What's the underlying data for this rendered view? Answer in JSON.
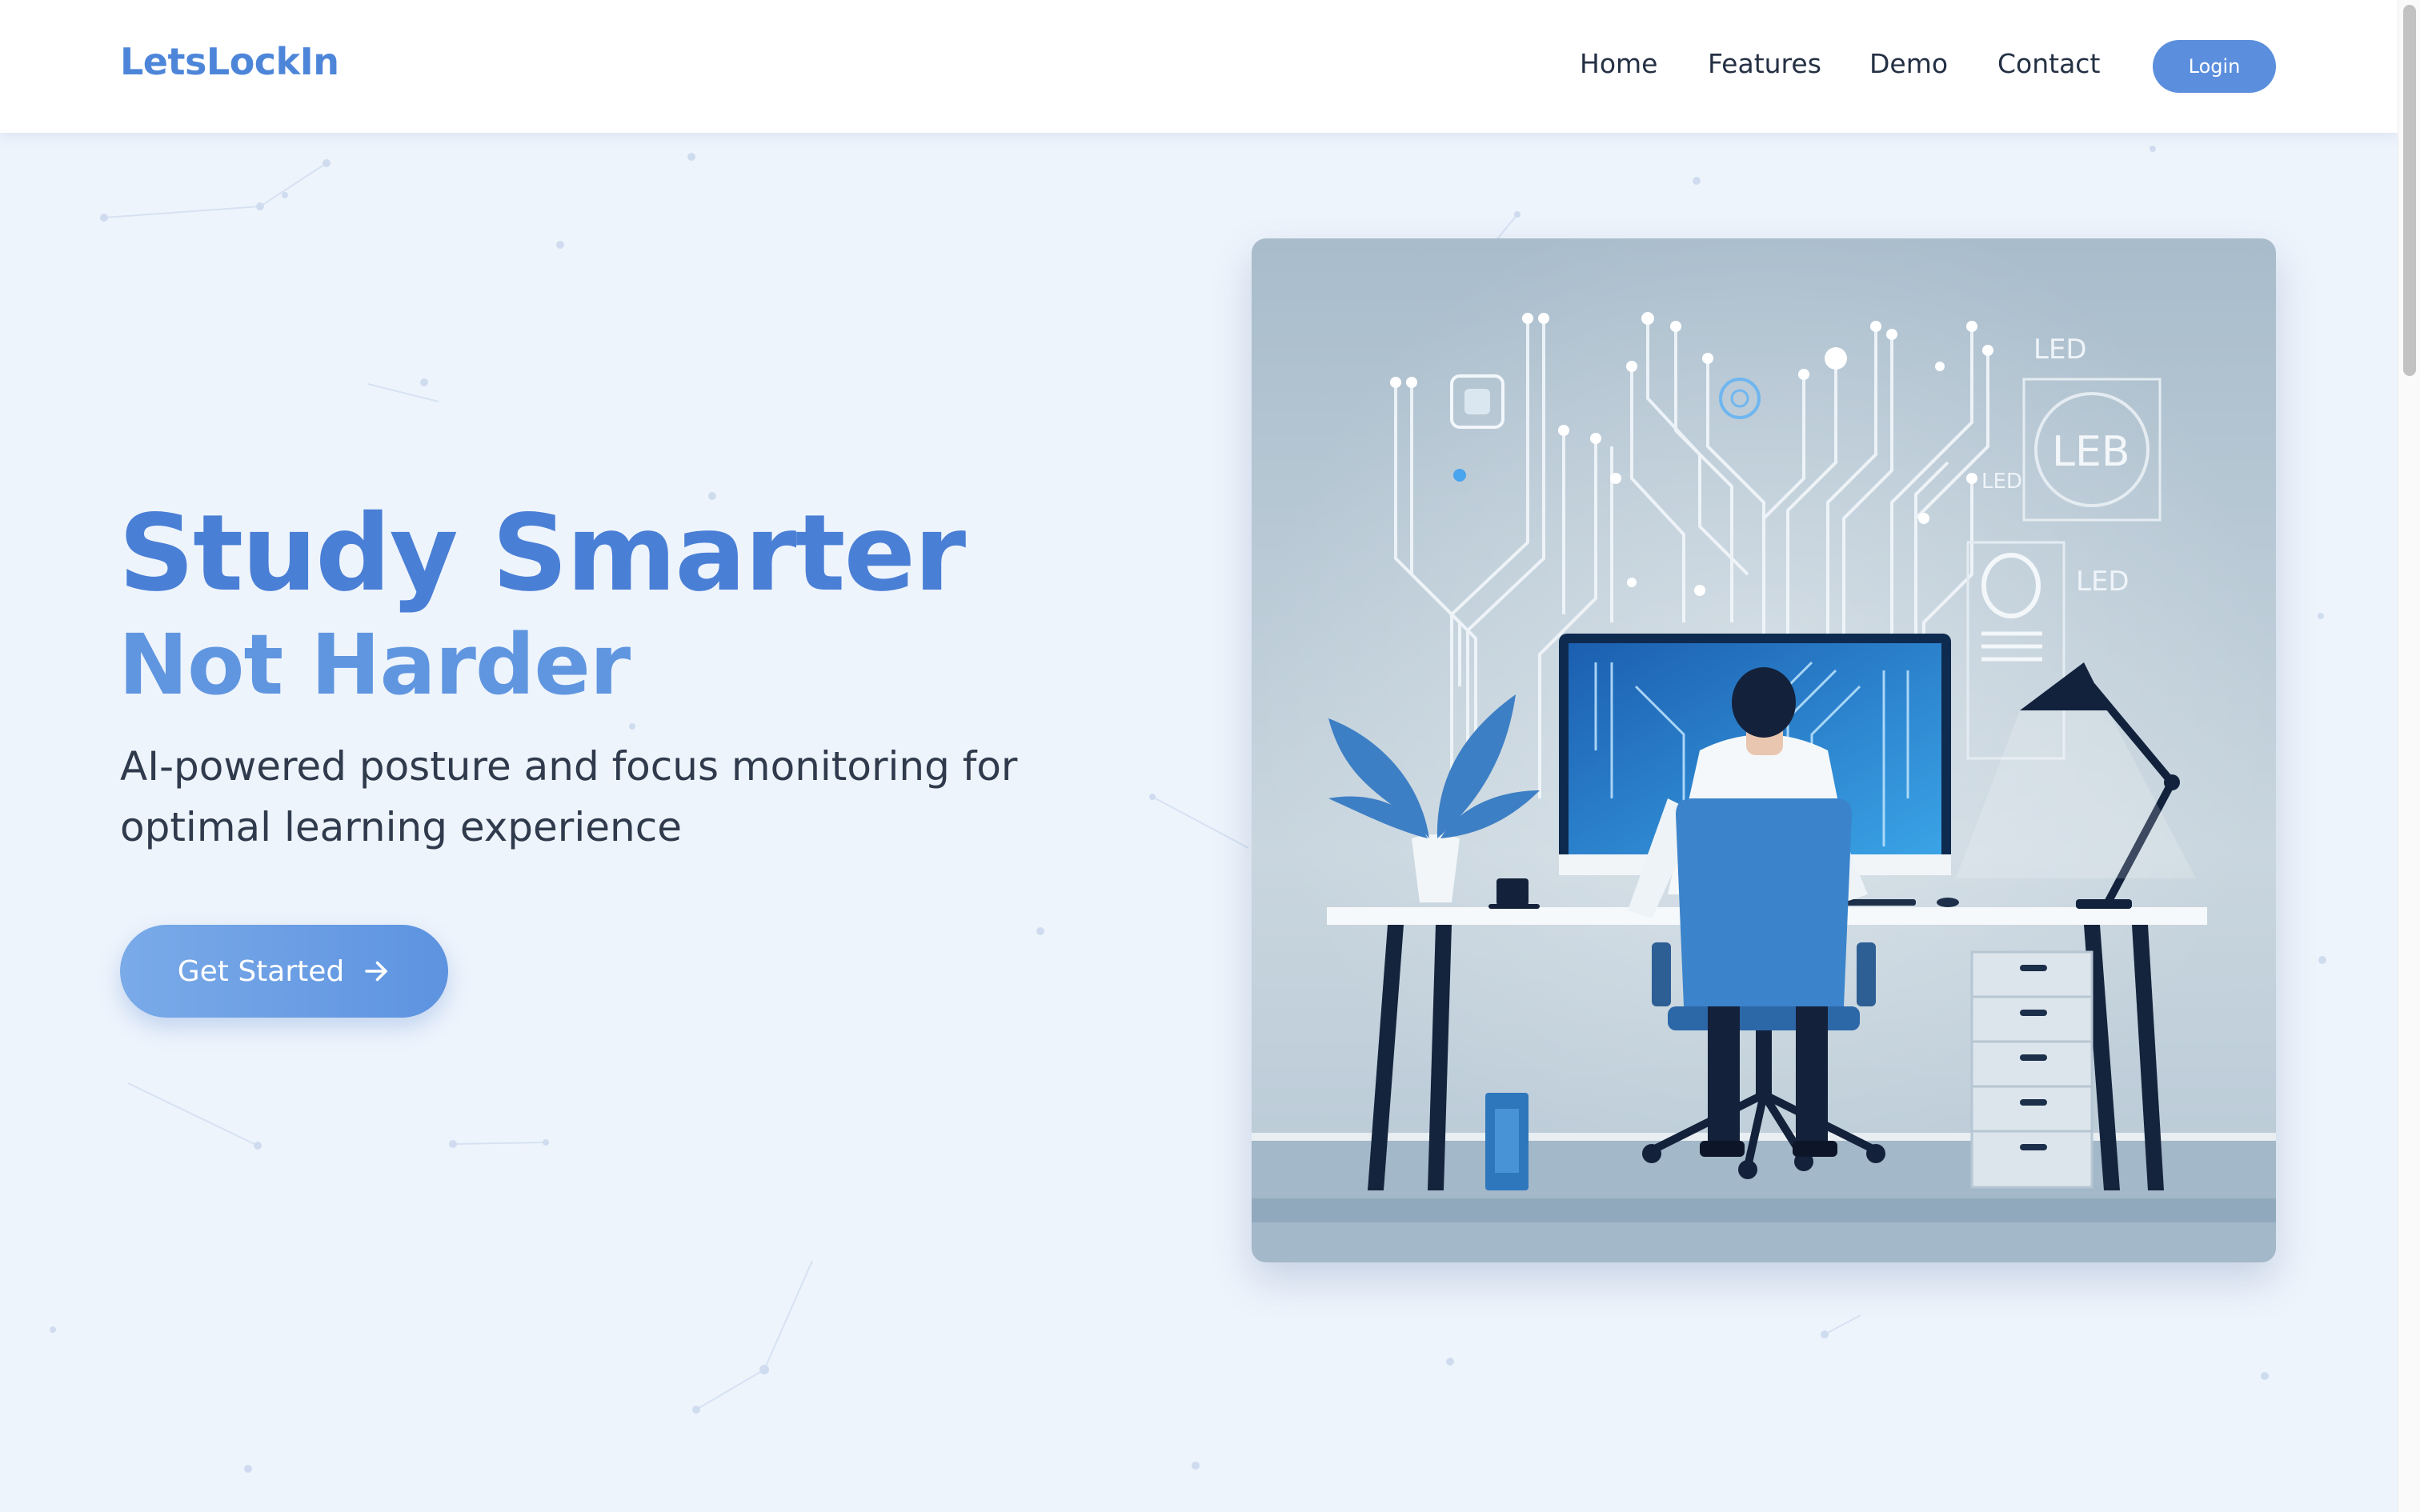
{
  "header": {
    "logo": "LetsLockIn",
    "nav_items": [
      {
        "label": "Home"
      },
      {
        "label": "Features"
      },
      {
        "label": "Demo"
      },
      {
        "label": "Contact"
      }
    ],
    "login_label": "Login"
  },
  "hero": {
    "title": "Study Smarter",
    "subtitle": "Not Harder",
    "description": "AI-powered posture and focus monitoring for optimal learning experience",
    "cta_label": "Get Started",
    "cta_icon": "arrow-right-icon",
    "illustration": {
      "labels": [
        "LED",
        "LEB",
        "LED",
        "LED"
      ]
    }
  },
  "colors": {
    "brand": "#4d86d9",
    "title": "#4a7fd6",
    "subtitle": "#6096e0",
    "background": "#eef4fc",
    "button": "#5b8fdd"
  }
}
